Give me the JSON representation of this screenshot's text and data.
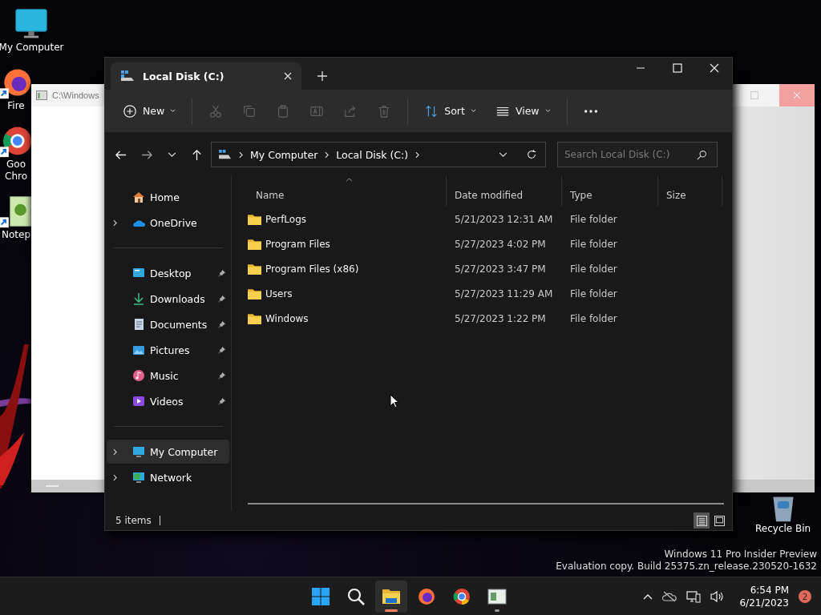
{
  "desktop_icons": [
    {
      "kind": "computer",
      "shortcut": false,
      "lines": [
        "My Computer"
      ]
    },
    {
      "kind": "firefox",
      "shortcut": true,
      "lines": [
        "Fire"
      ]
    },
    {
      "kind": "chrome",
      "shortcut": true,
      "lines": [
        "Goo",
        "Chro"
      ]
    },
    {
      "kind": "notepad",
      "shortcut": true,
      "lines": [
        "Notep"
      ]
    }
  ],
  "recycle_bin": {
    "label": "Recycle Bin"
  },
  "background_window": {
    "title": "C:\\Windows"
  },
  "explorer": {
    "tabs": [
      {
        "title": "Local Disk (C:)",
        "selected": true
      }
    ],
    "toolbar": [
      {
        "kind": "new",
        "label": "New",
        "disabled": false
      },
      {
        "kind": "cut",
        "disabled": true
      },
      {
        "kind": "copy",
        "disabled": true
      },
      {
        "kind": "paste",
        "disabled": true
      },
      {
        "kind": "rename",
        "disabled": true
      },
      {
        "kind": "share",
        "disabled": true
      },
      {
        "kind": "delete",
        "disabled": true
      },
      {
        "kind": "sort",
        "label": "Sort",
        "disabled": false
      },
      {
        "kind": "view",
        "label": "View",
        "disabled": false
      },
      {
        "kind": "more",
        "disabled": false
      }
    ],
    "breadcrumbs": [
      "My Computer",
      "Local Disk (C:)"
    ],
    "search": {
      "placeholder": "Search Local Disk (C:)"
    },
    "sidebar_groups": [
      [
        {
          "kind": "home",
          "label": "Home",
          "expandable": false,
          "pinned": false,
          "selected": false
        },
        {
          "kind": "onedrive",
          "label": "OneDrive",
          "expandable": true,
          "pinned": false,
          "selected": false
        }
      ],
      [
        {
          "kind": "desktop",
          "label": "Desktop",
          "expandable": false,
          "pinned": true,
          "selected": false
        },
        {
          "kind": "downloads",
          "label": "Downloads",
          "expandable": false,
          "pinned": true,
          "selected": false
        },
        {
          "kind": "documents",
          "label": "Documents",
          "expandable": false,
          "pinned": true,
          "selected": false
        },
        {
          "kind": "pictures",
          "label": "Pictures",
          "expandable": false,
          "pinned": true,
          "selected": false
        },
        {
          "kind": "music",
          "label": "Music",
          "expandable": false,
          "pinned": true,
          "selected": false
        },
        {
          "kind": "videos",
          "label": "Videos",
          "expandable": false,
          "pinned": true,
          "selected": false
        }
      ],
      [
        {
          "kind": "computer",
          "label": "My Computer",
          "expandable": true,
          "pinned": false,
          "selected": true
        },
        {
          "kind": "network",
          "label": "Network",
          "expandable": true,
          "pinned": false,
          "selected": false
        }
      ]
    ],
    "columns": [
      {
        "label": "Name",
        "sorted": true
      },
      {
        "label": "Date modified",
        "sorted": false
      },
      {
        "label": "Type",
        "sorted": false
      },
      {
        "label": "Size",
        "sorted": false
      }
    ],
    "rows": [
      {
        "name": "PerfLogs",
        "date": "5/21/2023 12:31 AM",
        "type": "File folder"
      },
      {
        "name": "Program Files",
        "date": "5/27/2023 4:02 PM",
        "type": "File folder"
      },
      {
        "name": "Program Files (x86)",
        "date": "5/27/2023 3:47 PM",
        "type": "File folder"
      },
      {
        "name": "Users",
        "date": "5/27/2023 11:29 AM",
        "type": "File folder"
      },
      {
        "name": "Windows",
        "date": "5/27/2023 1:22 PM",
        "type": "File folder"
      }
    ],
    "status": "5 items",
    "view_modes": [
      {
        "kind": "details",
        "selected": true
      },
      {
        "kind": "tiles",
        "selected": false
      }
    ]
  },
  "system_notice": [
    "Windows 11 Pro Insider Preview",
    "Evaluation copy. Build 25375.zn_release.230520-1632"
  ],
  "taskbar": {
    "apps": [
      {
        "kind": "start",
        "active": false,
        "running": false
      },
      {
        "kind": "search",
        "active": false,
        "running": false
      },
      {
        "kind": "explorer",
        "active": true,
        "running": true
      },
      {
        "kind": "firefox",
        "active": false,
        "running": false
      },
      {
        "kind": "chrome",
        "active": false,
        "running": false
      },
      {
        "kind": "notepad",
        "active": false,
        "running": true
      }
    ],
    "time": "6:54 PM",
    "date": "6/21/2023",
    "notifications": "2"
  }
}
